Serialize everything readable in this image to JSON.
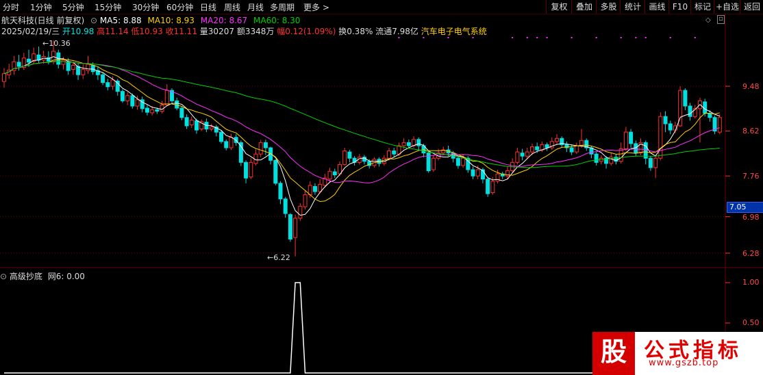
{
  "top_tabs": [
    "分时",
    "1分钟",
    "5分钟",
    "15分钟",
    "30分钟",
    "60分钟",
    "日线",
    "周线",
    "月线",
    "多周期",
    "更多 >"
  ],
  "right_buttons": [
    "复权",
    "叠加",
    "多股",
    "统计",
    "画线",
    "F10",
    "标记",
    "+自选",
    "返回"
  ],
  "info": {
    "name": "航天科技(日线 前复权)",
    "ma5": "MA5: 8.88",
    "ma10": "MA10: 8.93",
    "ma20": "MA20: 8.67",
    "ma60": "MA60: 8.30",
    "date": "2025/02/19/三",
    "open": "开10.98",
    "high": "高11.14",
    "low": "低10.93",
    "close": "收11.11",
    "vol": "量30207",
    "amount": "额3348万",
    "amp": "幅0.12(1.09%)",
    "turnover": "换0.38%",
    "float": "流通7.98亿",
    "sector": "汽车电子电气系统"
  },
  "price_axis": [
    "9.48",
    "8.62",
    "7.76",
    "6.98",
    "6.28"
  ],
  "sub_axis": [
    "1.00",
    "0.50"
  ],
  "current_price": "7.05",
  "annotations": {
    "high_mark": "10.36",
    "low_mark": "6.22"
  },
  "sub_indicator": {
    "title": "高级抄底",
    "value": "网6: 0.00"
  },
  "logo": {
    "mark": "股",
    "text": "公式指标",
    "url": "www.gszb.top"
  },
  "colors": {
    "up": "#ff3030",
    "down": "#00e0e0",
    "ma5": "#ffffff",
    "ma10": "#ffd000",
    "ma20": "#ff30ff",
    "ma60": "#00d000",
    "grid": "#6a0000",
    "signal": "#ffffff"
  },
  "candles": [
    [
      9.57,
      9.72,
      9.83,
      9.45
    ],
    [
      9.7,
      9.79,
      9.91,
      9.62
    ],
    [
      9.78,
      9.95,
      10.06,
      9.7
    ],
    [
      9.94,
      9.86,
      10.08,
      9.78
    ],
    [
      9.84,
      10.02,
      10.12,
      9.79
    ],
    [
      10.0,
      9.94,
      10.18,
      9.85
    ],
    [
      9.96,
      10.1,
      10.22,
      9.9
    ],
    [
      10.08,
      9.98,
      10.24,
      9.92
    ],
    [
      9.98,
      10.05,
      10.16,
      9.91
    ],
    [
      10.03,
      9.96,
      10.15,
      9.9
    ],
    [
      9.95,
      10.15,
      10.36,
      9.9
    ],
    [
      10.12,
      9.9,
      10.18,
      9.82
    ],
    [
      9.9,
      9.98,
      10.04,
      9.8
    ],
    [
      9.95,
      9.78,
      10.02,
      9.7
    ],
    [
      9.8,
      9.88,
      9.95,
      9.7
    ],
    [
      9.86,
      9.7,
      9.92,
      9.6
    ],
    [
      9.7,
      9.8,
      9.9,
      9.62
    ],
    [
      9.78,
      9.9,
      10.06,
      9.72
    ],
    [
      9.88,
      9.76,
      9.94,
      9.7
    ],
    [
      9.78,
      9.7,
      9.85,
      9.6
    ],
    [
      9.7,
      9.55,
      9.74,
      9.5
    ],
    [
      9.55,
      9.47,
      9.62,
      9.4
    ],
    [
      9.48,
      9.6,
      9.67,
      9.41
    ],
    [
      9.58,
      9.38,
      9.62,
      9.3
    ],
    [
      9.38,
      9.2,
      9.42,
      9.16
    ],
    [
      9.2,
      9.3,
      9.37,
      9.12
    ],
    [
      9.3,
      9.1,
      9.34,
      9.05
    ],
    [
      9.1,
      9.22,
      9.3,
      9.03
    ],
    [
      9.22,
      9.05,
      9.28,
      8.98
    ],
    [
      9.06,
      8.98,
      9.12,
      8.92
    ],
    [
      8.97,
      9.03,
      9.1,
      8.92
    ],
    [
      9.03,
      9.0,
      9.07,
      8.95
    ],
    [
      9.0,
      9.12,
      9.2,
      8.96
    ],
    [
      9.12,
      9.4,
      9.52,
      9.1
    ],
    [
      9.4,
      9.2,
      9.44,
      9.14
    ],
    [
      9.2,
      9.06,
      9.26,
      9.02
    ],
    [
      9.06,
      8.88,
      9.1,
      8.83
    ],
    [
      8.88,
      8.72,
      8.94,
      8.66
    ],
    [
      8.74,
      8.83,
      8.9,
      8.68
    ],
    [
      8.82,
      8.64,
      8.86,
      8.57
    ],
    [
      8.66,
      8.8,
      8.84,
      8.62
    ],
    [
      8.79,
      8.66,
      8.86,
      8.6
    ],
    [
      8.66,
      8.7,
      8.76,
      8.62
    ],
    [
      8.7,
      8.6,
      8.74,
      8.52
    ],
    [
      8.6,
      8.42,
      8.64,
      8.38
    ],
    [
      8.42,
      8.3,
      8.46,
      8.25
    ],
    [
      8.3,
      8.5,
      8.57,
      8.26
    ],
    [
      8.5,
      8.4,
      8.56,
      8.34
    ],
    [
      8.4,
      8.02,
      8.44,
      7.95
    ],
    [
      8.02,
      7.72,
      8.06,
      7.62
    ],
    [
      7.74,
      8.02,
      8.1,
      7.7
    ],
    [
      8.0,
      8.18,
      8.27,
      7.96
    ],
    [
      8.18,
      8.4,
      8.45,
      8.12
    ],
    [
      8.4,
      8.3,
      8.46,
      8.16
    ],
    [
      8.3,
      8.06,
      8.32,
      7.98
    ],
    [
      8.06,
      7.62,
      8.08,
      7.58
    ],
    [
      7.62,
      7.32,
      7.66,
      7.22
    ],
    [
      7.32,
      7.04,
      7.36,
      6.96
    ],
    [
      7.02,
      6.55,
      7.05,
      6.5
    ],
    [
      6.58,
      6.95,
      7.02,
      6.22
    ],
    [
      6.95,
      7.18,
      7.24,
      6.9
    ],
    [
      7.17,
      7.4,
      7.48,
      7.12
    ],
    [
      7.4,
      7.58,
      7.66,
      7.34
    ],
    [
      7.56,
      7.46,
      7.62,
      7.4
    ],
    [
      7.46,
      7.6,
      7.7,
      7.42
    ],
    [
      7.58,
      7.72,
      7.8,
      7.54
    ],
    [
      7.7,
      7.85,
      7.92,
      7.64
    ],
    [
      7.84,
      7.78,
      7.9,
      7.72
    ],
    [
      7.8,
      7.98,
      8.04,
      7.76
    ],
    [
      7.98,
      8.24,
      8.3,
      7.96
    ],
    [
      8.22,
      8.1,
      8.26,
      8.02
    ],
    [
      8.1,
      8.02,
      8.14,
      7.96
    ],
    [
      8.02,
      8.12,
      8.18,
      7.98
    ],
    [
      8.12,
      8.04,
      8.16,
      7.98
    ],
    [
      8.04,
      7.96,
      8.08,
      7.9
    ],
    [
      7.96,
      8.08,
      8.12,
      7.92
    ],
    [
      8.08,
      8.0,
      8.12,
      7.94
    ],
    [
      8.0,
      8.1,
      8.16,
      7.96
    ],
    [
      8.1,
      8.24,
      8.3,
      8.06
    ],
    [
      8.24,
      8.18,
      8.3,
      8.12
    ],
    [
      8.18,
      8.34,
      8.4,
      8.14
    ],
    [
      8.34,
      8.4,
      8.48,
      8.28
    ],
    [
      8.4,
      8.34,
      8.46,
      8.28
    ],
    [
      8.34,
      8.46,
      8.52,
      8.3
    ],
    [
      8.46,
      8.34,
      8.5,
      8.26
    ],
    [
      8.34,
      8.2,
      8.38,
      8.12
    ],
    [
      8.2,
      7.86,
      8.24,
      7.82
    ],
    [
      7.88,
      8.1,
      8.16,
      7.84
    ],
    [
      8.1,
      8.2,
      8.28,
      8.06
    ],
    [
      8.2,
      8.26,
      8.32,
      8.16
    ],
    [
      8.26,
      8.2,
      8.34,
      8.14
    ],
    [
      8.2,
      8.1,
      8.24,
      8.02
    ],
    [
      8.1,
      7.96,
      8.14,
      7.9
    ],
    [
      7.96,
      8.1,
      8.18,
      7.92
    ],
    [
      8.1,
      7.88,
      8.14,
      7.82
    ],
    [
      7.88,
      7.76,
      7.94,
      7.7
    ],
    [
      7.76,
      7.88,
      7.96,
      7.7
    ],
    [
      7.88,
      7.7,
      7.92,
      7.62
    ],
    [
      7.7,
      7.42,
      7.74,
      7.36
    ],
    [
      7.44,
      7.66,
      7.74,
      7.4
    ],
    [
      7.66,
      7.8,
      7.88,
      7.62
    ],
    [
      7.8,
      7.76,
      7.84,
      7.7
    ],
    [
      7.76,
      7.86,
      7.94,
      7.7
    ],
    [
      7.86,
      8.02,
      8.1,
      7.82
    ],
    [
      8.02,
      8.22,
      8.3,
      7.98
    ],
    [
      8.2,
      8.14,
      8.28,
      8.06
    ],
    [
      8.14,
      8.22,
      8.3,
      8.08
    ],
    [
      8.22,
      8.32,
      8.38,
      8.16
    ],
    [
      8.32,
      8.26,
      8.4,
      8.2
    ],
    [
      8.26,
      8.36,
      8.42,
      8.22
    ],
    [
      8.36,
      8.3,
      8.4,
      8.24
    ],
    [
      8.3,
      8.42,
      8.5,
      8.26
    ],
    [
      8.42,
      8.48,
      8.56,
      8.36
    ],
    [
      8.48,
      8.36,
      8.52,
      8.3
    ],
    [
      8.36,
      8.3,
      8.42,
      8.22
    ],
    [
      8.3,
      8.22,
      8.36,
      8.16
    ],
    [
      8.22,
      8.34,
      8.4,
      8.18
    ],
    [
      8.34,
      8.44,
      8.66,
      8.3
    ],
    [
      8.44,
      8.3,
      8.48,
      8.24
    ],
    [
      8.3,
      8.18,
      8.34,
      8.1
    ],
    [
      8.18,
      8.02,
      8.22,
      7.96
    ],
    [
      8.04,
      8.1,
      8.16,
      7.98
    ],
    [
      8.1,
      8.0,
      8.14,
      7.9
    ],
    [
      8.0,
      8.12,
      8.2,
      7.96
    ],
    [
      8.12,
      8.04,
      8.18,
      7.98
    ],
    [
      8.04,
      8.28,
      8.4,
      8.0
    ],
    [
      8.28,
      8.6,
      8.7,
      8.24
    ],
    [
      8.6,
      8.38,
      8.66,
      8.3
    ],
    [
      8.38,
      8.2,
      8.44,
      8.14
    ],
    [
      8.2,
      8.4,
      8.48,
      8.16
    ],
    [
      8.4,
      8.1,
      8.44,
      7.98
    ],
    [
      8.1,
      7.92,
      8.14,
      7.86
    ],
    [
      7.92,
      8.1,
      8.16,
      7.72
    ],
    [
      8.1,
      8.9,
      8.98,
      8.06
    ],
    [
      8.9,
      8.76,
      9.0,
      8.6
    ],
    [
      8.76,
      8.64,
      8.82,
      8.56
    ],
    [
      8.64,
      8.72,
      8.8,
      8.58
    ],
    [
      8.72,
      9.4,
      9.48,
      8.7
    ],
    [
      9.4,
      9.1,
      9.44,
      9.02
    ],
    [
      9.1,
      8.9,
      9.16,
      8.82
    ],
    [
      8.9,
      9.05,
      9.12,
      8.86
    ],
    [
      9.05,
      9.2,
      9.26,
      8.4
    ],
    [
      9.18,
      8.96,
      9.24,
      8.9
    ],
    [
      8.96,
      8.88,
      9.02,
      8.8
    ],
    [
      8.88,
      8.62,
      8.92,
      8.56
    ],
    [
      8.6,
      8.88,
      8.94,
      8.56
    ]
  ],
  "signal_series": [
    0,
    0,
    0,
    0,
    0,
    0,
    0,
    0,
    0,
    0,
    0,
    0,
    0,
    0,
    0,
    0,
    0,
    0,
    0,
    0,
    0,
    0,
    0,
    0,
    0,
    0,
    0,
    0,
    0,
    0,
    0,
    0,
    0,
    0,
    0,
    0,
    0,
    0,
    0,
    0,
    0,
    0,
    0,
    0,
    0,
    0,
    0,
    0,
    0,
    0,
    0,
    0,
    0,
    0,
    0,
    0,
    0,
    0,
    0,
    1,
    1,
    0,
    0,
    0,
    0,
    0,
    0,
    0,
    0,
    0,
    0,
    0,
    0,
    0,
    0,
    0,
    0,
    0,
    0,
    0,
    0,
    0,
    0,
    0,
    0,
    0,
    0,
    0,
    0,
    0,
    0,
    0,
    0,
    0,
    0,
    0,
    0,
    0,
    0,
    0,
    0,
    0,
    0,
    0,
    0,
    0,
    0,
    0,
    0,
    0,
    0,
    0,
    0,
    0,
    0,
    0,
    0,
    0,
    0,
    0,
    0,
    0,
    0,
    0,
    0,
    0,
    0,
    0,
    0,
    0,
    0,
    0,
    0,
    0,
    0,
    0,
    0,
    0,
    0,
    0,
    0,
    0,
    0,
    0,
    0,
    0,
    0,
    0,
    0,
    0,
    0
  ],
  "signal_dots": [
    80,
    85,
    90,
    95,
    103,
    106,
    108,
    110,
    115,
    120,
    125,
    128,
    130,
    135,
    140
  ]
}
